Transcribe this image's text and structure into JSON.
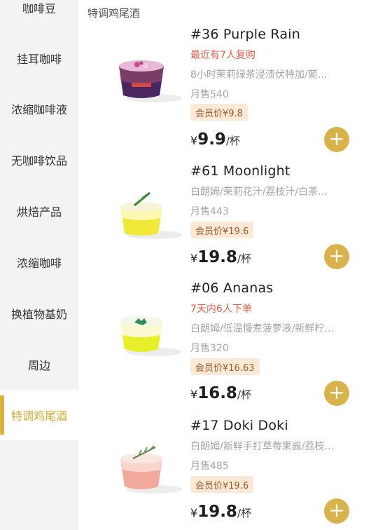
{
  "sidebar": {
    "items": [
      {
        "label": "咖啡豆"
      },
      {
        "label": "挂耳咖啡"
      },
      {
        "label": "浓缩咖啡液"
      },
      {
        "label": "无咖啡饮品"
      },
      {
        "label": "烘焙产品"
      },
      {
        "label": "浓缩咖啡"
      },
      {
        "label": "换植物基奶"
      },
      {
        "label": "周边"
      },
      {
        "label": "特调鸡尾酒",
        "active": true
      }
    ]
  },
  "section": {
    "title": "特调鸡尾酒"
  },
  "products": [
    {
      "name": "#36 Purple Rain",
      "tag": "最近有7人复购",
      "desc": "8小时茉莉绿茶浸渍伏特加/葡…",
      "sales": "月售540",
      "member_price": "会员价¥9.8",
      "price_currency": "¥",
      "price": "9.9",
      "unit": "/杯",
      "add": "+"
    },
    {
      "name": "#61 Moonlight",
      "tag": "",
      "desc": "白朗姆/茉莉花汁/荔枝汁/白茶…",
      "sales": "月售443",
      "member_price": "会员价¥19.6",
      "price_currency": "¥",
      "price": "19.8",
      "unit": "/杯",
      "add": "+"
    },
    {
      "name": "#06 Ananas",
      "tag": "7天内6人下单",
      "desc": "白朗姆/低温慢煮菠萝液/新鲜柠…",
      "sales": "月售320",
      "member_price": "会员价¥16.63",
      "price_currency": "¥",
      "price": "16.8",
      "unit": "/杯",
      "add": "+"
    },
    {
      "name": "#17 Doki Doki",
      "tag": "",
      "desc": "白朗姆/新鲜手打草莓果酱/荔枝…",
      "sales": "月售485",
      "member_price": "会员价¥19.6",
      "price_currency": "¥",
      "price": "19.8",
      "unit": "/杯",
      "add": "+"
    }
  ]
}
